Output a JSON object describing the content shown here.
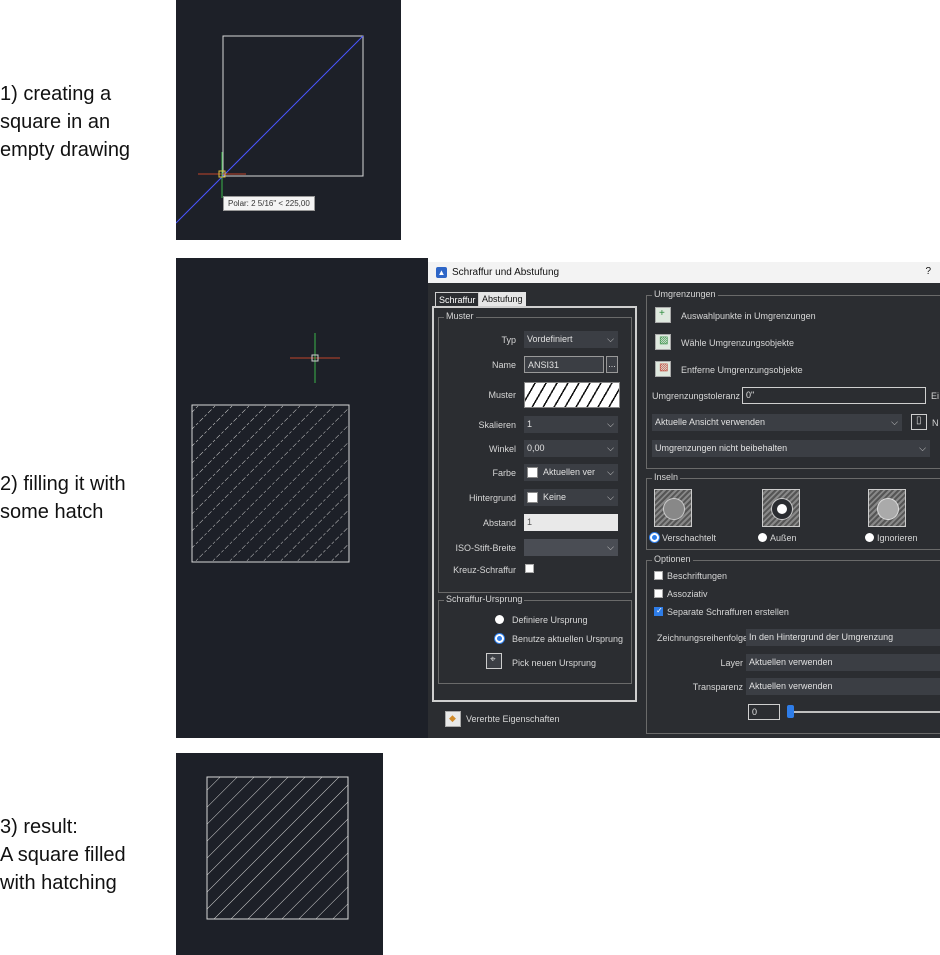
{
  "steps": [
    {
      "caption_line1": "1) creating a",
      "caption_line2": "square in an",
      "caption_line3": "empty drawing"
    },
    {
      "caption_line1": "2) filling it with",
      "caption_line2": "some hatch"
    },
    {
      "caption_line1": "3) result:",
      "caption_line2": "A square filled",
      "caption_line3": "with hatching"
    }
  ],
  "tooltip": "Polar: 2 5/16\" < 225,00",
  "dialog": {
    "title": "Schraffur und Abstufung",
    "help": "?",
    "tabs": [
      "Schraffur",
      "Abstufung"
    ],
    "muster": {
      "group": "Muster",
      "typ_label": "Typ",
      "typ_value": "Vordefiniert",
      "name_label": "Name",
      "name_value": "ANSI31",
      "name_browse": "...",
      "muster_label": "Muster",
      "skalieren_label": "Skalieren",
      "skalieren_value": "1",
      "winkel_label": "Winkel",
      "winkel_value": "0,00",
      "farbe_label": "Farbe",
      "farbe_value": "Aktuellen ver",
      "hintergrund_label": "Hintergrund",
      "hintergrund_value": "Keine",
      "abstand_label": "Abstand",
      "abstand_value": "1",
      "iso_label": "ISO-Stift-Breite",
      "iso_value": "",
      "kreuz_label": "Kreuz-Schraffur",
      "kreuz_checked": false
    },
    "ursprung": {
      "group": "Schraffur-Ursprung",
      "option1": "Definiere Ursprung",
      "option2": "Benutze aktuellen Ursprung",
      "selected": "option2",
      "pick": "Pick neuen Ursprung"
    },
    "vererbte": "Vererbte Eigenschaften",
    "umgrenzungen": {
      "group": "Umgrenzungen",
      "btn1": "Auswahlpunkte in Umgrenzungen",
      "btn2": "Wähle Umgrenzungsobjekte",
      "btn3": "Entferne Umgrenzungsobjekte",
      "toleranz_label": "Umgrenzungstoleranz",
      "toleranz_value": "0\"",
      "toleranz_suffix": "Ei",
      "ansicht_value": "Aktuelle Ansicht verwenden",
      "ansicht_suffix": "N",
      "behalten_value": "Umgrenzungen nicht beibehalten"
    },
    "inseln": {
      "group": "Inseln",
      "opt1": "Verschachtelt",
      "opt2": "Außen",
      "opt3": "Ignorieren",
      "selected": "opt1"
    },
    "optionen": {
      "group": "Optionen",
      "beschriftungen": "Beschriftungen",
      "beschriftungen_checked": false,
      "assoziativ": "Assoziativ",
      "assoziativ_checked": false,
      "separate": "Separate Schraffuren erstellen",
      "separate_checked": true,
      "zeichnungsfolge_label": "Zeichnungsreihenfolge",
      "zeichnungsfolge_value": "In den Hintergrund der Umgrenzung",
      "layer_label": "Layer",
      "layer_value": "Aktuellen verwenden",
      "transparenz_label": "Transparenz",
      "transparenz_value": "Aktuellen verwenden",
      "transparenz_number": "0",
      "transparenz_level": 0
    }
  },
  "colors": {
    "cad_bg": "#1d2028",
    "accent": "#2e7de9",
    "dialog_bg": "#2b2d31"
  }
}
